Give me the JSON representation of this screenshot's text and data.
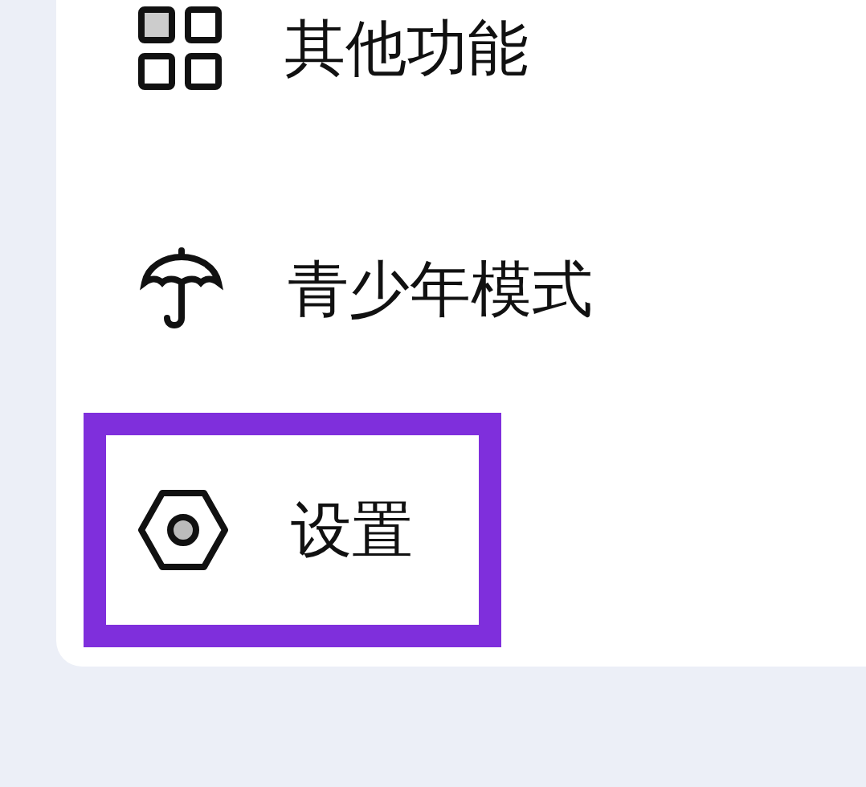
{
  "menu": {
    "items": [
      {
        "label": "其他功能",
        "highlighted": false
      },
      {
        "label": "青少年模式",
        "highlighted": false
      },
      {
        "label": "设置",
        "highlighted": true
      }
    ]
  }
}
